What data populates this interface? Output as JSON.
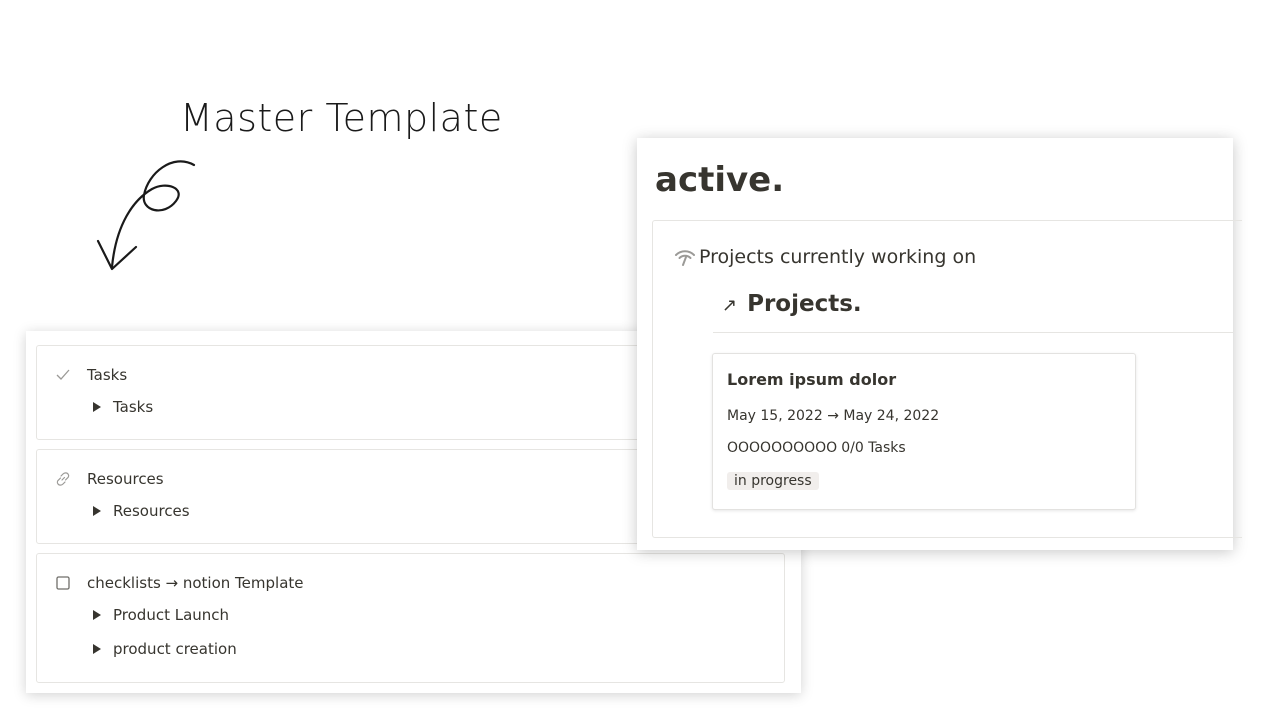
{
  "annotation": {
    "title": "Master Template"
  },
  "left_panel": {
    "callouts": [
      {
        "icon": "check-icon",
        "label": "Tasks",
        "toggles": [
          "Tasks"
        ]
      },
      {
        "icon": "link-icon",
        "label": "Resources",
        "toggles": [
          "Resources"
        ]
      },
      {
        "icon": "checkbox-icon",
        "label": "checklists → notion Template",
        "toggles": [
          "Product Launch",
          "product creation"
        ]
      }
    ]
  },
  "right_panel": {
    "heading": "active.",
    "callout_icon": "signal-icon",
    "description": "Projects currently working on",
    "link_arrow": "↗",
    "link_title": "Projects.",
    "card": {
      "title": "Lorem ipsum dolor",
      "dates": "May 15, 2022 → May 24, 2022",
      "progress_circles": "OOOOOOOOOO",
      "progress_text": "0/0 Tasks",
      "status": "in progress"
    }
  },
  "colors": {
    "text": "#37352f",
    "muted_icon": "#9b9a97",
    "border": "#e6e5e2",
    "tag_bg": "#f1eeec"
  }
}
